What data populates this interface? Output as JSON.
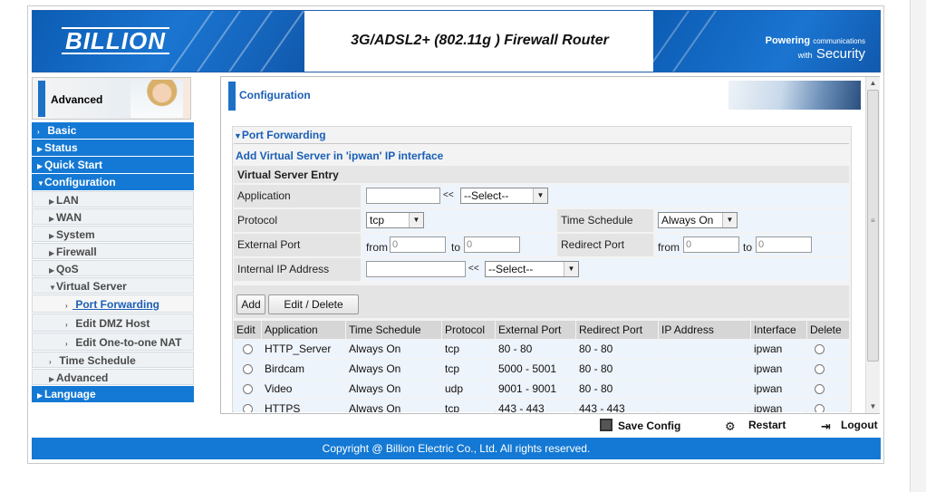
{
  "header": {
    "logo": "BILLION",
    "router_title": "3G/ADSL2+ (802.11g ) Firewall Router",
    "tagline_1a": "Powering",
    "tagline_1b": "communications",
    "tagline_2a": "with",
    "tagline_2b": "Security"
  },
  "sidebar": {
    "advanced_label": "Advanced",
    "items": [
      {
        "label": "Basic"
      },
      {
        "label": "Status"
      },
      {
        "label": "Quick Start"
      },
      {
        "label": "Configuration"
      },
      {
        "label": "LAN"
      },
      {
        "label": "WAN"
      },
      {
        "label": "System"
      },
      {
        "label": "Firewall"
      },
      {
        "label": "QoS"
      },
      {
        "label": "Virtual Server"
      },
      {
        "label": "Port Forwarding"
      },
      {
        "label": "Edit DMZ Host"
      },
      {
        "label": "Edit One-to-one NAT"
      },
      {
        "label": "Time Schedule"
      },
      {
        "label": "Advanced"
      },
      {
        "label": "Language"
      }
    ]
  },
  "main": {
    "config_title": "Configuration",
    "section_title": "Port Forwarding",
    "add_title": "Add Virtual Server in 'ipwan' IP interface",
    "entry_title": "Virtual Server Entry",
    "form": {
      "application_label": "Application",
      "application_value": "",
      "app_select": "--Select--",
      "arrows": "<<",
      "protocol_label": "Protocol",
      "protocol_value": "tcp",
      "time_schedule_label": "Time Schedule",
      "time_schedule_value": "Always On",
      "external_port_label": "External Port",
      "from_label": "from",
      "to_label": "to",
      "ext_from": "0",
      "ext_to": "0",
      "redirect_port_label": "Redirect Port",
      "redir_from": "0",
      "redir_to": "0",
      "internal_ip_label": "Internal IP Address",
      "internal_ip_value": "",
      "ip_select": "--Select--"
    },
    "buttons": {
      "add": "Add",
      "edit_delete": "Edit / Delete"
    },
    "table": {
      "headers": [
        "Edit",
        "Application",
        "Time Schedule",
        "Protocol",
        "External Port",
        "Redirect Port",
        "IP Address",
        "Interface",
        "Delete"
      ],
      "rows": [
        {
          "application": "HTTP_Server",
          "schedule": "Always On",
          "protocol": "tcp",
          "external": "80 - 80",
          "redirect": "80 - 80",
          "ip": "",
          "interface": "ipwan"
        },
        {
          "application": "Birdcam",
          "schedule": "Always On",
          "protocol": "tcp",
          "external": "5000 - 5001",
          "redirect": "80 - 80",
          "ip": "",
          "interface": "ipwan"
        },
        {
          "application": "Video",
          "schedule": "Always On",
          "protocol": "udp",
          "external": "9001 - 9001",
          "redirect": "80 - 80",
          "ip": "",
          "interface": "ipwan"
        },
        {
          "application": "HTTPS",
          "schedule": "Always On",
          "protocol": "tcp",
          "external": "443 - 443",
          "redirect": "443 - 443",
          "ip": "",
          "interface": "ipwan"
        }
      ]
    }
  },
  "footer": {
    "save_config": "Save Config",
    "restart": "Restart",
    "logout": "Logout",
    "copyright": "Copyright @ Billion Electric Co., Ltd. All rights reserved."
  },
  "colors": {
    "brand_blue": "#1479d4",
    "link_blue": "#1b5fb6"
  }
}
